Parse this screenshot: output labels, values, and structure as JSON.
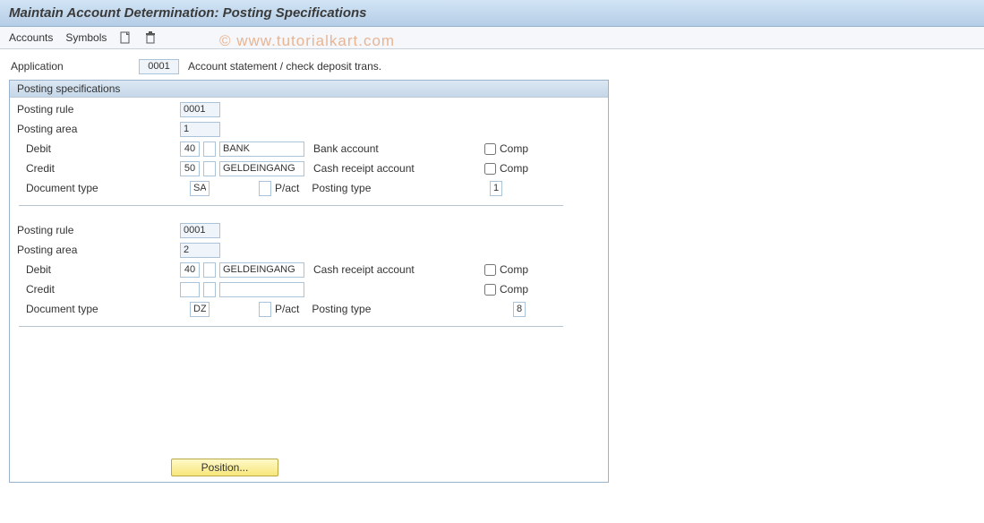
{
  "title": "Maintain Account Determination: Posting Specifications",
  "toolbar": {
    "accounts": "Accounts",
    "symbols": "Symbols"
  },
  "application": {
    "label": "Application",
    "value": "0001",
    "description": "Account statement / check deposit trans."
  },
  "container": {
    "title": "Posting specifications",
    "labels": {
      "posting_rule": "Posting rule",
      "posting_area": "Posting area",
      "debit": "Debit",
      "credit": "Credit",
      "document_type": "Document type",
      "pact": "P/act",
      "posting_type": "Posting type",
      "comp": "Comp"
    },
    "blocks": [
      {
        "posting_rule": "0001",
        "posting_area": "1",
        "debit": {
          "key": "40",
          "acct": "BANK",
          "desc": "Bank account",
          "comp": false
        },
        "credit": {
          "key": "50",
          "acct": "GELDEINGANG",
          "desc": "Cash receipt account",
          "comp": false
        },
        "doc_type": "SA",
        "pact_field": "",
        "posting_type": "1"
      },
      {
        "posting_rule": "0001",
        "posting_area": "2",
        "debit": {
          "key": "40",
          "acct": "GELDEINGANG",
          "desc": "Cash receipt account",
          "comp": false
        },
        "credit": {
          "key": "",
          "acct": "",
          "desc": "",
          "comp": false
        },
        "doc_type": "DZ",
        "pact_field": "",
        "posting_type": "8"
      }
    ]
  },
  "position_button": "Position...",
  "watermark": "© www.tutorialkart.com"
}
